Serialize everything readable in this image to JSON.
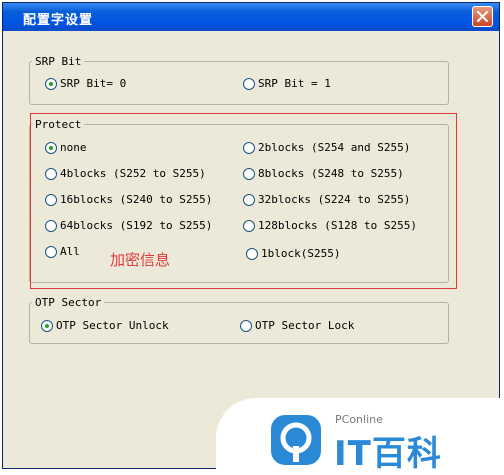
{
  "window": {
    "title": "配置字设置"
  },
  "srp_group": {
    "label": "SRP Bit",
    "options": [
      {
        "label": "SRP Bit= 0",
        "selected": true
      },
      {
        "label": "SRP Bit = 1",
        "selected": false
      }
    ]
  },
  "protect_group": {
    "label": "Protect",
    "options": [
      {
        "label": "none",
        "selected": true
      },
      {
        "label": "2blocks (S254 and S255)",
        "selected": false
      },
      {
        "label": "4blocks (S252 to S255)",
        "selected": false
      },
      {
        "label": "8blocks (S248 to S255)",
        "selected": false
      },
      {
        "label": "16blocks (S240 to S255)",
        "selected": false
      },
      {
        "label": "32blocks (S224 to S255)",
        "selected": false
      },
      {
        "label": "64blocks (S192 to S255)",
        "selected": false
      },
      {
        "label": "128blocks (S128 to S255)",
        "selected": false
      },
      {
        "label": "All",
        "selected": false
      },
      {
        "label": "1block(S255)",
        "selected": false
      }
    ]
  },
  "annotation": {
    "text": "加密信息",
    "color": "#e23a3a"
  },
  "otp_group": {
    "label": "OTP Sector",
    "options": [
      {
        "label": "OTP Sector Unlock",
        "selected": true
      },
      {
        "label": "OTP Sector Lock",
        "selected": false
      }
    ]
  },
  "watermark": {
    "small": "PConline",
    "brand": "IT百科",
    "color": "#2b8ad8"
  },
  "colors": {
    "titlebar": "#0054e3",
    "dialog_bg": "#ece9d8",
    "radio_dot": "#21a121",
    "highlight": "#e23a3a"
  },
  "icons": [
    "close-icon",
    "radio-icon",
    "pconline-logo-icon"
  ]
}
